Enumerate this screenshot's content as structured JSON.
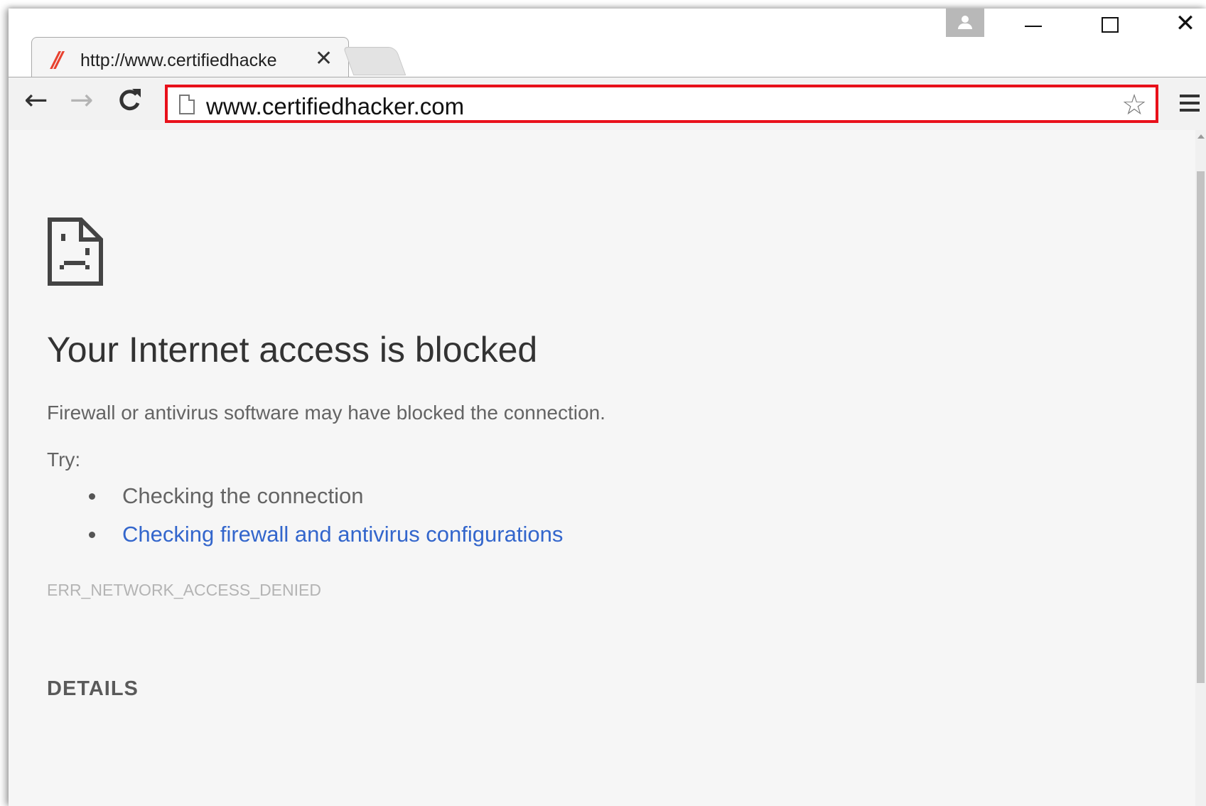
{
  "browser": {
    "tab": {
      "title": "http://www.certifiedhacke",
      "close_glyph": "✕"
    },
    "window_controls": {
      "close_glyph": "✕"
    },
    "toolbar": {
      "back_glyph": "←",
      "forward_glyph": "→",
      "reload_glyph": "C",
      "url": "www.certifiedhacker.com",
      "bookmark_glyph": "☆"
    },
    "highlight_color": "#e8101a"
  },
  "error_page": {
    "heading": "Your Internet access is blocked",
    "message": "Firewall or antivirus software may have blocked the connection.",
    "try_label": "Try:",
    "suggestions": [
      "Checking the connection",
      "Checking firewall and antivirus configurations"
    ],
    "error_code": "ERR_NETWORK_ACCESS_DENIED",
    "details_label": "DETAILS",
    "link_color": "#3366cc"
  }
}
